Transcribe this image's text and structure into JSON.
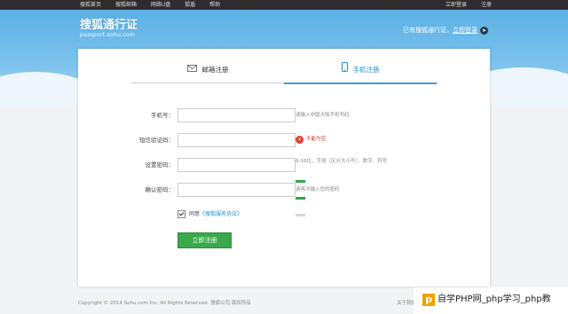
{
  "topbar": {
    "nav": [
      "搜狐首页",
      "搜狐邮箱",
      "网络U盘",
      "狐盾",
      "帮助"
    ],
    "login": "立即登录",
    "register": "注册"
  },
  "logo": {
    "title": "搜狐通行证",
    "subtitle": "passport.sohu.com"
  },
  "header": {
    "prompt": "已有搜狐通行证，",
    "login_link": "立即登录"
  },
  "tabs": [
    {
      "label": "邮箱注册",
      "icon": "mail-icon",
      "active": false
    },
    {
      "label": "手机注册",
      "icon": "mobile-phone-icon",
      "active": true
    }
  ],
  "form": {
    "phone": {
      "label": "手机号：",
      "value": "",
      "hint": "请输入中国大陆手机号码"
    },
    "sms_code": {
      "label": "短信验证码：",
      "value": "",
      "error": "不能为空"
    },
    "password": {
      "label": "设置密码：",
      "value": "",
      "hint": "6-16位，字母（区分大小写）、数字、符号",
      "strength_segments": 3,
      "strength_filled": 2
    },
    "confirm": {
      "label": "确认密码：",
      "value": "",
      "hint": "请再次输入您的密码"
    },
    "agree": {
      "checked": true,
      "text": "同意",
      "link": "《搜狐服务协议》"
    },
    "submit": "立即注册"
  },
  "footer": {
    "copyright": "Copyright © 2014 Sohu.com Inc. All Rights Reserved. 搜狐公司 版权所有",
    "about": "关于我们"
  },
  "watermark": {
    "text": "自学PHP网_php学习_php教",
    "logo_letter": "p"
  },
  "colors": {
    "accent": "#1e8fd6",
    "submit": "#3aa84b",
    "error": "#e43b2d",
    "topbar": "#2d2d2d"
  }
}
